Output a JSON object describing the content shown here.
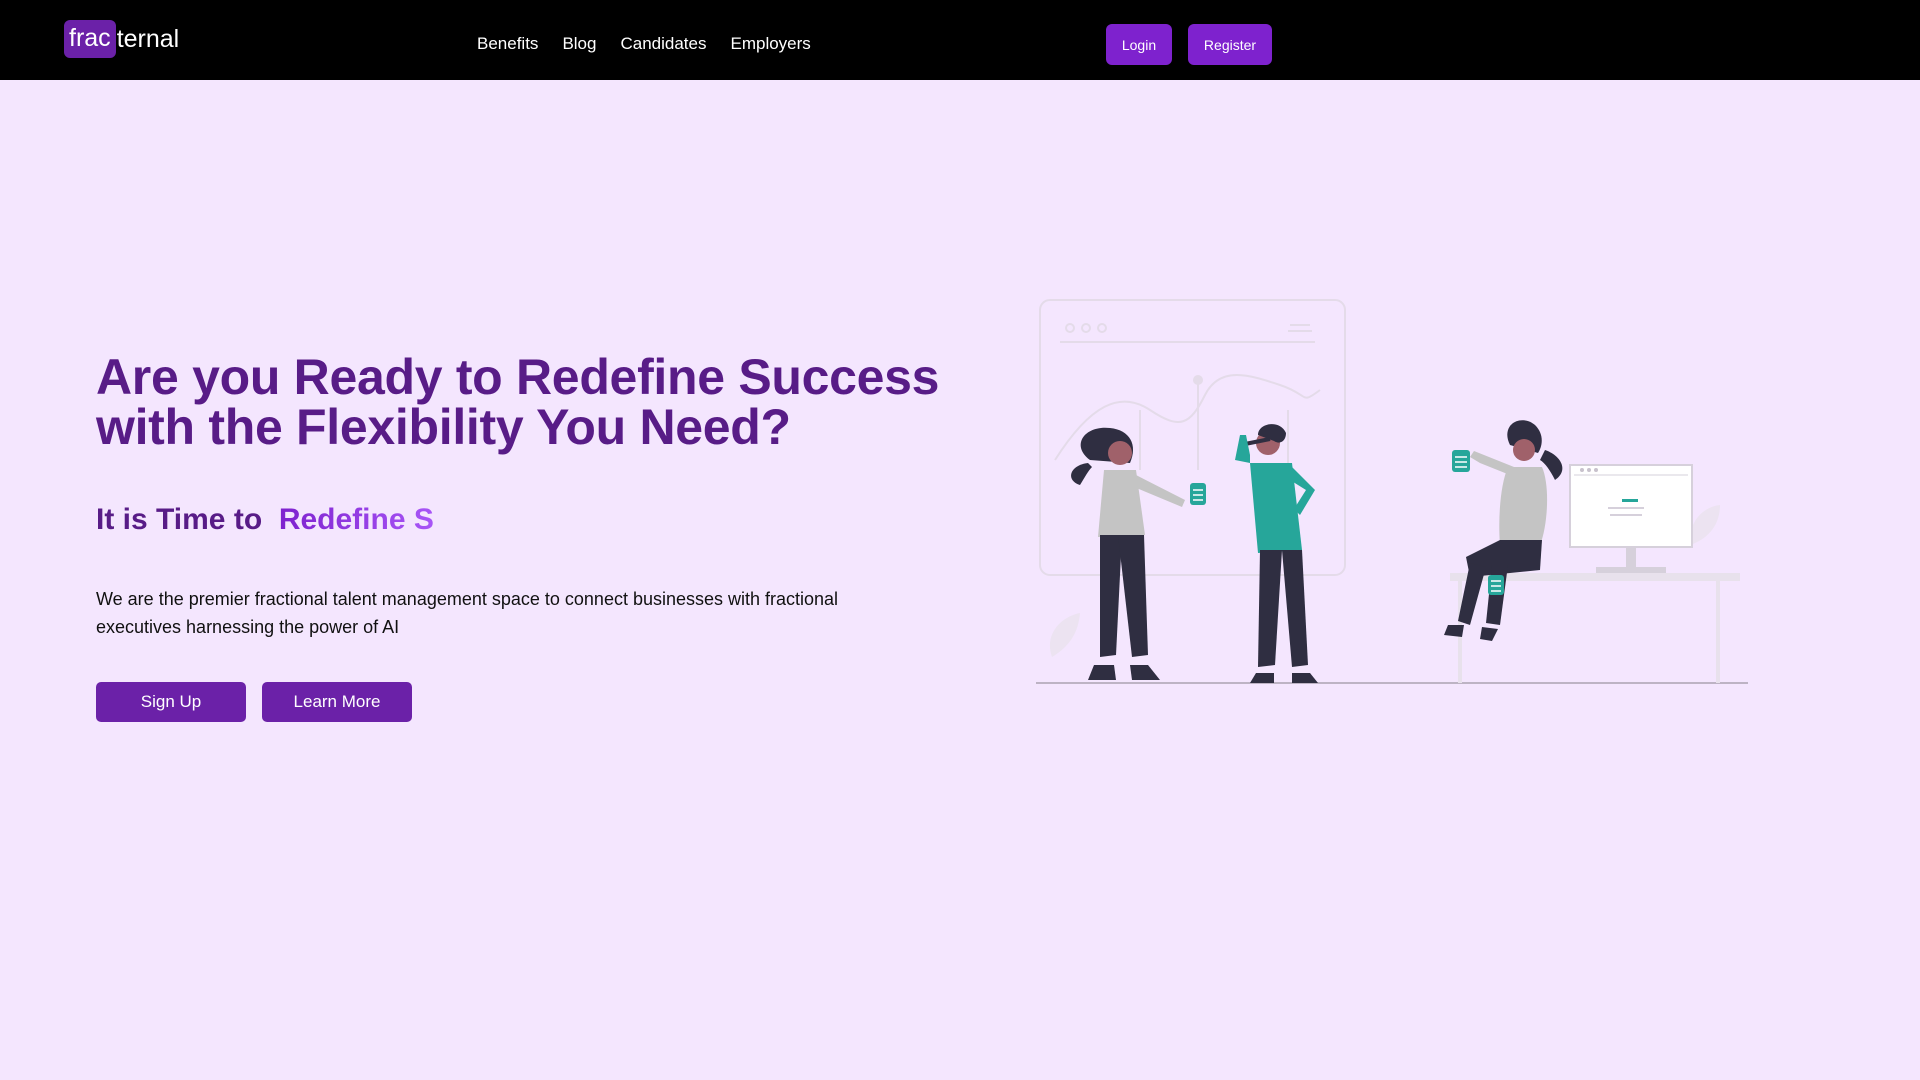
{
  "nav": {
    "logo_highlight": "frac",
    "logo_rest": "ternal",
    "links": [
      "Benefits",
      "Blog",
      "Candidates",
      "Employers"
    ],
    "login_label": "Login",
    "register_label": "Register"
  },
  "hero": {
    "title": "Are you Ready to Redefine Success with the Flexibility You Need?",
    "subtitle_prefix": "It is Time to  ",
    "subtitle_typed": "Redefine S",
    "description": "We are the premier fractional talent management space to connect businesses with fractional executives harnessing the power of AI",
    "signup_label": "Sign Up",
    "learn_more_label": "Learn More"
  },
  "colors": {
    "background": "#f4e6fe",
    "navbar": "#000000",
    "primary": "#6b21a8",
    "accent": "#7e22ce",
    "heading": "#581c87",
    "illustration_accent": "#26a69a"
  },
  "icons": {
    "illustration": "team-collaboration-illustration"
  }
}
